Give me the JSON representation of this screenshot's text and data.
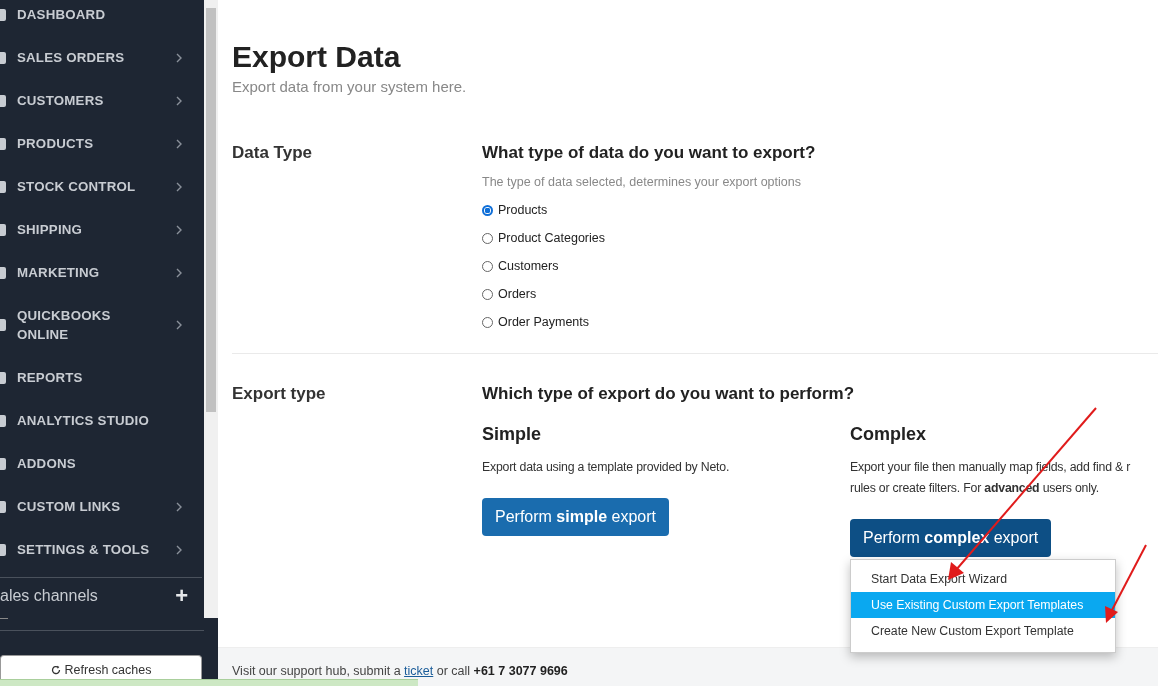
{
  "sidebar": {
    "items": [
      {
        "label": "DASHBOARD",
        "has_submenu": false
      },
      {
        "label": "SALES ORDERS",
        "has_submenu": true
      },
      {
        "label": "CUSTOMERS",
        "has_submenu": true
      },
      {
        "label": "PRODUCTS",
        "has_submenu": true
      },
      {
        "label": "STOCK CONTROL",
        "has_submenu": true
      },
      {
        "label": "SHIPPING",
        "has_submenu": true
      },
      {
        "label": "MARKETING",
        "has_submenu": true
      },
      {
        "label": "QUICKBOOKS ONLINE",
        "has_submenu": true
      },
      {
        "label": "REPORTS",
        "has_submenu": false
      },
      {
        "label": "ANALYTICS STUDIO",
        "has_submenu": false
      },
      {
        "label": "ADDONS",
        "has_submenu": false
      },
      {
        "label": "CUSTOM LINKS",
        "has_submenu": true
      },
      {
        "label": "SETTINGS & TOOLS",
        "has_submenu": true
      }
    ],
    "sales_channels": {
      "label": "ales channels",
      "add": "+"
    },
    "refresh_button": "Refresh caches"
  },
  "page": {
    "title": "Export Data",
    "subtitle": "Export data from your system here.",
    "data_type": {
      "label": "Data Type",
      "question": "What type of data do you want to export?",
      "hint": "The type of data selected, determines your export options",
      "options": [
        {
          "label": "Products",
          "selected": true
        },
        {
          "label": "Product Categories",
          "selected": false
        },
        {
          "label": "Customers",
          "selected": false
        },
        {
          "label": "Orders",
          "selected": false
        },
        {
          "label": "Order Payments",
          "selected": false
        }
      ]
    },
    "export_type": {
      "label": "Export type",
      "question": "Which type of export do you want to perform?",
      "simple": {
        "title": "Simple",
        "description": [
          "Export data using a template provided by Neto."
        ],
        "button": "Perform **simple** export"
      },
      "complex": {
        "title": "Complex",
        "description": [
          "Export your file then manually map fields, add find & r",
          "rules or create filters. For **advanced** users only."
        ],
        "button": "Perform **complex** export",
        "menu": [
          {
            "label": "Start Data Export Wizard",
            "selected": false
          },
          {
            "label": "Use Existing Custom Export Templates",
            "selected": true
          },
          {
            "label": "Create New Custom Export Template",
            "selected": false
          }
        ]
      }
    }
  },
  "footer": {
    "parts": [
      {
        "kind": "text",
        "text": "Visit our support hub, submit a "
      },
      {
        "kind": "link",
        "text": "ticket"
      },
      {
        "kind": "text",
        "text": " or call "
      },
      {
        "kind": "bold",
        "text": "+61 7 3077 9696"
      }
    ]
  }
}
